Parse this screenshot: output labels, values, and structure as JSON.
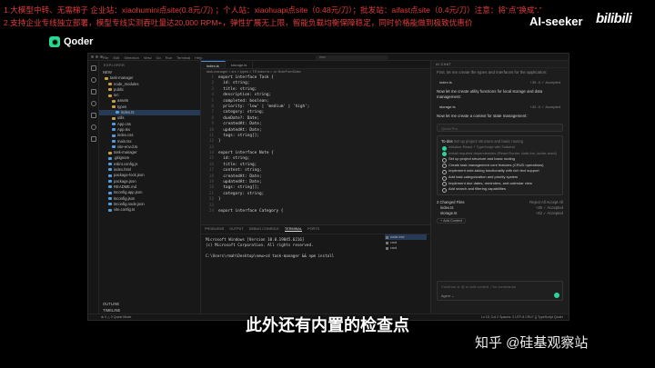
{
  "banner": {
    "line1": "1.大模型中转、无需梯子  企业站：xiaohumini点site(0.8元/刀) ；个人站：xiaohuapi点site（0.48元/刀）；批发站：aifast点site（0.4元/刀）注意：将“点”换成“.”",
    "line2": "2.支持企业专线独立部署，模型专线实测吞吐量达20,000 RPM+，弹性扩展无上限，智能负载均衡保障稳定，同时价格能做到极致优惠价"
  },
  "channel": "AI-seeker",
  "bili_logo": "bilibili",
  "app": {
    "logo_text": "Qoder"
  },
  "ide": {
    "menu": [
      "File",
      "Edit",
      "Selection",
      "View",
      "Go",
      "Run",
      "Terminal",
      "Help"
    ],
    "search": "new",
    "explorer": {
      "title": "EXPLORER",
      "section": "NEW",
      "items": [
        {
          "label": "task-manager",
          "type": "folder",
          "indent": 0
        },
        {
          "label": "node_modules",
          "type": "folder",
          "indent": 1
        },
        {
          "label": "public",
          "type": "folder",
          "indent": 1
        },
        {
          "label": "src",
          "type": "folder",
          "indent": 1
        },
        {
          "label": "assets",
          "type": "folder",
          "indent": 2
        },
        {
          "label": "types",
          "type": "folder",
          "indent": 2
        },
        {
          "label": "index.ts",
          "type": "file",
          "indent": 3,
          "selected": true
        },
        {
          "label": "utils",
          "type": "folder",
          "indent": 2
        },
        {
          "label": "App.css",
          "type": "file",
          "indent": 2
        },
        {
          "label": "App.tsx",
          "type": "file",
          "indent": 2
        },
        {
          "label": "index.css",
          "type": "file",
          "indent": 2
        },
        {
          "label": "main.tsx",
          "type": "file",
          "indent": 2
        },
        {
          "label": "vite-env.d.ts",
          "type": "file",
          "indent": 2
        },
        {
          "label": "task-manager",
          "type": "folder",
          "indent": 1
        },
        {
          "label": ".gitignore",
          "type": "file",
          "indent": 1
        },
        {
          "label": "eslint.config.js",
          "type": "file",
          "indent": 1
        },
        {
          "label": "index.html",
          "type": "file",
          "indent": 1
        },
        {
          "label": "package-lock.json",
          "type": "file",
          "indent": 1
        },
        {
          "label": "package.json",
          "type": "file",
          "indent": 1
        },
        {
          "label": "README.md",
          "type": "file",
          "indent": 1
        },
        {
          "label": "tsconfig.app.json",
          "type": "file",
          "indent": 1
        },
        {
          "label": "tsconfig.json",
          "type": "file",
          "indent": 1
        },
        {
          "label": "tsconfig.node.json",
          "type": "file",
          "indent": 1
        },
        {
          "label": "vite.config.ts",
          "type": "file",
          "indent": 1
        }
      ],
      "outline": "OUTLINE",
      "timeline": "TIMELINE"
    },
    "tabs": [
      {
        "label": "index.ts",
        "active": true
      },
      {
        "label": "storage.ts",
        "active": false
      }
    ],
    "breadcrumb": "task-manager > src > types > TS index.ts > ••• NoteFormData",
    "code": [
      "export interface Task {",
      "  id: string;",
      "  title: string;",
      "  description: string;",
      "  completed: boolean;",
      "  priority: 'low' | 'medium' | 'high';",
      "  category: string;",
      "  dueDate?: Date;",
      "  createdAt: Date;",
      "  updatedAt: Date;",
      "  tags: string[];",
      "}",
      "",
      "export interface Note {",
      "  id: string;",
      "  title: string;",
      "  content: string;",
      "  createdAt: Date;",
      "  updatedAt: Date;",
      "  tags: string[];",
      "  category: string;",
      "}",
      "",
      "export interface Category {"
    ],
    "terminal": {
      "tabs": [
        "PROBLEMS",
        "OUTPUT",
        "DEBUG CONSOLE",
        "TERMINAL",
        "PORTS"
      ],
      "active_tab": "TERMINAL",
      "lines": [
        "Microsoft Windows [Version 10.0.19045.6216]",
        "(c) Microsoft Corporation. All rights reserved.",
        "",
        "C:\\Users\\rmah\\Desktop\\new>cd task-manager && npm install"
      ],
      "sessions": [
        "node.exe",
        "cmd",
        "cmd"
      ]
    },
    "agent": {
      "header": "AI CHAT",
      "msg_top": "First, let me create the types and interfaces for the application:",
      "chip1": {
        "file": "index.ts",
        "status": "+35 -0  ✓ Accepted"
      },
      "msg2": "Now let me create utility functions for local storage and data management:",
      "chip2": {
        "file": "storage.ts",
        "status": "+42 -0  ✓ Accepted"
      },
      "msg3": "Now let me create a context for state management:",
      "input_placeholder": "Quest Pro",
      "todo": {
        "title": "To-dos",
        "subtitle": "Set up project structure and basic routing",
        "items": [
          {
            "label": "Initialize React + TypeScript with Tailwind",
            "done": true
          },
          {
            "label": "Install required dependencies (React Router, date-fns, lucide-react)",
            "done": true
          },
          {
            "label": "Set up project structure and basic routing",
            "done": false
          },
          {
            "label": "Create task management core features (CRUD operations)",
            "done": false
          },
          {
            "label": "Implement note-taking functionality with rich text support",
            "done": false
          },
          {
            "label": "Add task categorization and priority system",
            "done": false
          },
          {
            "label": "Implement due dates, reminders, and calendar view",
            "done": false
          },
          {
            "label": "Add search and filtering capabilities",
            "done": false
          }
        ]
      },
      "changed": {
        "title": "2 Changed Files",
        "actions": "Reject All  Accept All",
        "files": [
          {
            "file": "index.ts",
            "status": "+35  ✓ Accepted"
          },
          {
            "file": "storage.ts",
            "status": "+42  ✓ Accepted"
          }
        ]
      },
      "add_context": "+ Add Context",
      "compose_placeholder": "Continue or @ to add context, / for commands",
      "mode": "Agent ⌄"
    },
    "status": {
      "left": "⊗ 0 △ 0   Quest Mode",
      "right": "Ln 15, Col 2   Spaces: 2   UTF-8   CRLF   {} TypeScript   Qoder"
    }
  },
  "subtitle": "此外还有内置的检查点",
  "watermark": "知乎 @硅基观察站"
}
